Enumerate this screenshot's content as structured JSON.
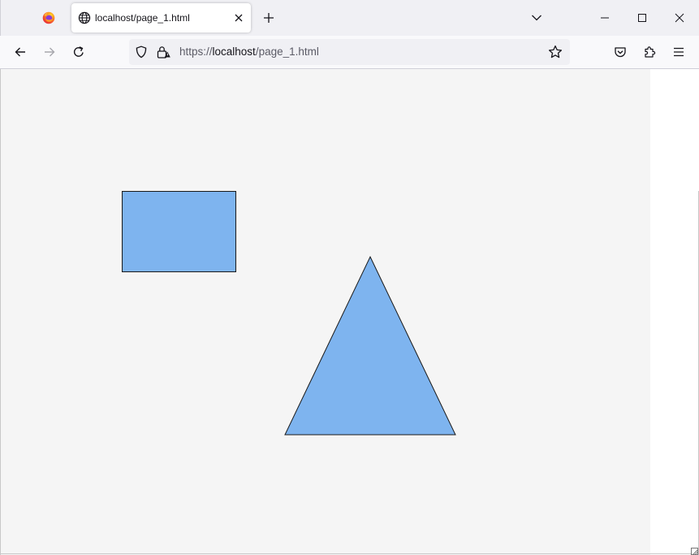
{
  "browser": {
    "tab": {
      "title": "localhost/page_1.html"
    },
    "urlbar": {
      "scheme": "https://",
      "host": "localhost",
      "path": "/page_1.html"
    },
    "icons": {
      "app": "firefox-icon",
      "tab_favicon": "globe-icon",
      "tab_close": "close-icon",
      "new_tab": "plus-icon",
      "tab_list": "chevron-down-icon",
      "minimize": "minimize-icon",
      "maximize": "maximize-icon",
      "close_window": "close-icon",
      "back": "arrow-left-icon",
      "forward": "arrow-right-icon",
      "reload": "reload-icon",
      "tracking_protection": "shield-icon",
      "security": "lock-icon",
      "bookmark": "star-icon",
      "pocket": "pocket-icon",
      "extensions": "puzzle-icon",
      "menu": "hamburger-icon"
    }
  },
  "page": {
    "background_color": "#f5f5f5",
    "shapes": [
      {
        "type": "rectangle",
        "fill": "#7eb4ef",
        "stroke": "#1a1a1a"
      },
      {
        "type": "triangle",
        "fill": "#7eb4ef",
        "stroke": "#1a1a1a"
      }
    ]
  }
}
